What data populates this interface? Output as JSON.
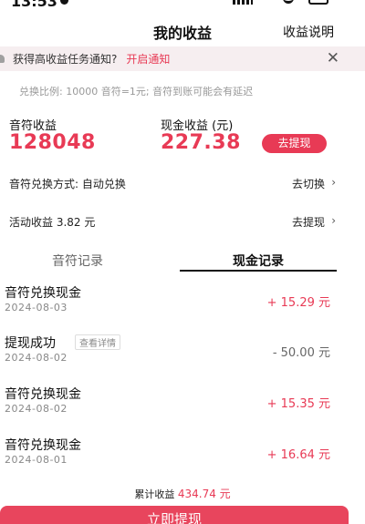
{
  "status": {
    "time": "13:53"
  },
  "nav": {
    "title": "我的收益",
    "right_link": "收益说明"
  },
  "notice": {
    "text": "获得高收益任务通知?",
    "link": "开启通知",
    "close": "✕"
  },
  "exchange_ratio": "兑换比例: 10000 音符=1元; 音符到账可能会有延迟",
  "balances": {
    "notes_label": "音符收益",
    "notes_value": "128048",
    "cash_label": "现金收益 (元)",
    "cash_value": "227.38",
    "withdraw_pill": "去提现"
  },
  "exchange_method": {
    "label": "音符兑换方式: 自动兑换",
    "action": "去切换"
  },
  "activity": {
    "label": "活动收益 3.82 元",
    "action": "去提现"
  },
  "tabs": [
    {
      "label": "音符记录",
      "active": false
    },
    {
      "label": "现金记录",
      "active": true
    }
  ],
  "records": [
    {
      "title": "音符兑换现金",
      "date": "2024-08-03",
      "amount": "+ 15.29 元",
      "positive": true,
      "badge": ""
    },
    {
      "title": "提现成功",
      "date": "2024-08-02",
      "amount": "- 50.00 元",
      "positive": false,
      "badge": "查看详情"
    },
    {
      "title": "音符兑换现金",
      "date": "2024-08-02",
      "amount": "+ 15.35 元",
      "positive": true,
      "badge": ""
    },
    {
      "title": "音符兑换现金",
      "date": "2024-08-01",
      "amount": "+ 16.64 元",
      "positive": true,
      "badge": ""
    }
  ],
  "total": {
    "label": "累计收益",
    "value": "434.74 元"
  },
  "primary_button": "立即提现",
  "colors": {
    "accent": "#e83a55",
    "notice_bg": "#f6eef0"
  },
  "icons": {
    "close": "close-icon",
    "chevron": "chevron-right-icon",
    "bell": "bell-icon"
  }
}
